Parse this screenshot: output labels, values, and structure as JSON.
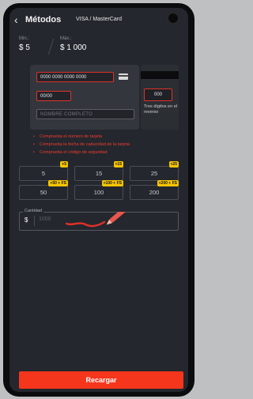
{
  "header": {
    "title": "Métodos",
    "subtitle": "VISA / MasterCard"
  },
  "limits": {
    "min_label": "Min.:",
    "min_value": "$ 5",
    "max_label": "Máx.:",
    "max_value": "$ 1 000"
  },
  "card_form": {
    "card_number_placeholder": "0000 0000 0000 0000",
    "expiry_placeholder": "00/00",
    "name_placeholder": "NOMBRE COMPLETO",
    "cvv_placeholder": "000",
    "cvv_hint": "Tres dígitos en el reverso"
  },
  "errors": [
    "Comprueba el número de tarjeta",
    "Comprueba la fecha de caducidad de la tarjeta",
    "Comprueba el código de seguridad"
  ],
  "amount_options": [
    {
      "value": "5",
      "bonus": "+5"
    },
    {
      "value": "15",
      "bonus": "+15"
    },
    {
      "value": "25",
      "bonus": "+25"
    },
    {
      "value": "50",
      "bonus": "+50 + FS"
    },
    {
      "value": "100",
      "bonus": "+100 + FS"
    },
    {
      "value": "200",
      "bonus": "+200 + FS"
    }
  ],
  "amount": {
    "label": "Cantidad",
    "currency": "$",
    "placeholder": "1000"
  },
  "submit_label": "Recargar",
  "colors": {
    "accent": "#f5361c",
    "error": "#f23b2f",
    "bonus_badge": "#f5c400",
    "background": "#24272d"
  }
}
